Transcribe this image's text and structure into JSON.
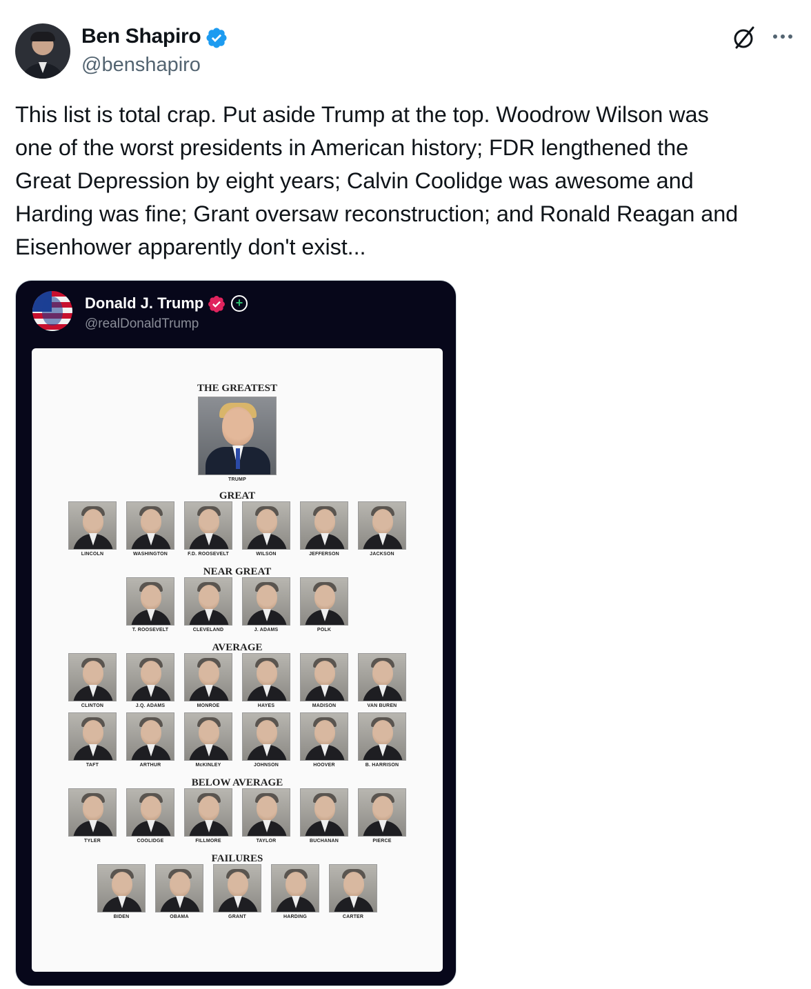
{
  "post": {
    "author_name": "Ben Shapiro",
    "author_handle": "@benshapiro",
    "verified_color": "#1d9bf0",
    "avatar_icon": "profile-photo",
    "grok_icon": "grok-slash-circle-icon",
    "more_icon": "more-dots-icon",
    "text": "This list is total crap. Put aside Trump at the top. Woodrow Wilson was\none of the worst presidents in American history; FDR lengthened the\nGreat Depression by eight years; Calvin Coolidge was awesome and\nHarding was fine; Grant oversaw reconstruction; and Ronald Reagan and\nEisenhower apparently don't exist..."
  },
  "media": {
    "author_name": "Donald J. Trump",
    "author_handle": "@realDonaldTrump",
    "badge_color": "#e0245e",
    "plus_icon": "plus-circle-icon",
    "background": "#07071a"
  },
  "chart_data": {
    "type": "table",
    "tiers": [
      {
        "label": "THE GREATEST",
        "names": [
          "TRUMP"
        ]
      },
      {
        "label": "GREAT",
        "names": [
          "LINCOLN",
          "WASHINGTON",
          "F.D. ROOSEVELT",
          "WILSON",
          "JEFFERSON",
          "JACKSON"
        ]
      },
      {
        "label": "NEAR GREAT",
        "names": [
          "T. ROOSEVELT",
          "CLEVELAND",
          "J. ADAMS",
          "POLK"
        ]
      },
      {
        "label": "AVERAGE",
        "names": [
          "CLINTON",
          "J.Q. ADAMS",
          "MONROE",
          "HAYES",
          "MADISON",
          "VAN BUREN",
          "TAFT",
          "ARTHUR",
          "McKINLEY",
          "JOHNSON",
          "HOOVER",
          "B. HARRISON"
        ]
      },
      {
        "label": "BELOW AVERAGE",
        "names": [
          "TYLER",
          "COOLIDGE",
          "FILLMORE",
          "TAYLOR",
          "BUCHANAN",
          "PIERCE"
        ]
      },
      {
        "label": "FAILURES",
        "names": [
          "BIDEN",
          "OBAMA",
          "GRANT",
          "HARDING",
          "CARTER"
        ]
      }
    ]
  }
}
